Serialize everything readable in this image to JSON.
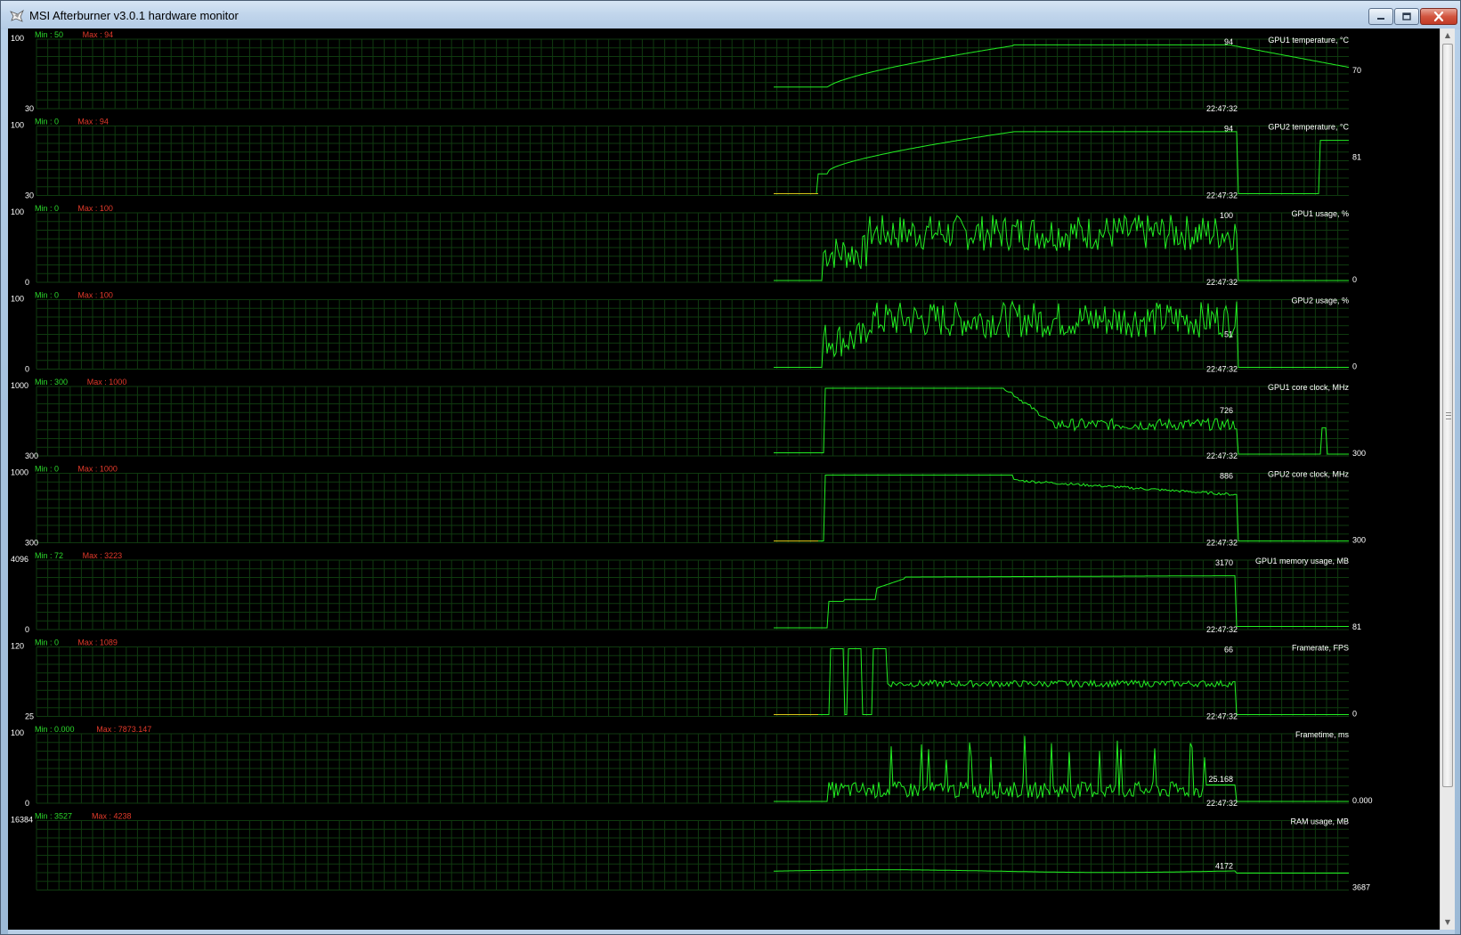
{
  "window": {
    "title": "MSI Afterburner v3.0.1 hardware monitor",
    "buttons": {
      "minimize": "minimize-icon",
      "maximize": "maximize-icon",
      "close": "close-icon"
    }
  },
  "colors": {
    "background": "#000000",
    "grid": "#0f3a0f",
    "trace": "#22ee22",
    "trace_idle": "#d8c818",
    "min_label": "#2bd92b",
    "max_label": "#e23a2a",
    "text": "#ffffff"
  },
  "monitor": {
    "timestamp": "22:47:32",
    "graphs": [
      {
        "title": "GPU1 temperature, °C",
        "min_text": "Min : 50",
        "max_text": "Max : 94",
        "y_top": "100",
        "y_bottom": "30",
        "current": "94",
        "right_value": "70"
      },
      {
        "title": "GPU2 temperature, °C",
        "min_text": "Min : 0",
        "max_text": "Max : 94",
        "y_top": "100",
        "y_bottom": "30",
        "current": "94",
        "right_value": "81"
      },
      {
        "title": "GPU1 usage, %",
        "min_text": "Min : 0",
        "max_text": "Max : 100",
        "y_top": "100",
        "y_bottom": "0",
        "current": "100",
        "right_value": "0"
      },
      {
        "title": "GPU2 usage, %",
        "min_text": "Min : 0",
        "max_text": "Max : 100",
        "y_top": "100",
        "y_bottom": "0",
        "current": "51",
        "right_value": "0"
      },
      {
        "title": "GPU1 core clock, MHz",
        "min_text": "Min : 300",
        "max_text": "Max : 1000",
        "y_top": "1000",
        "y_bottom": "300",
        "current": "726",
        "right_value": "300"
      },
      {
        "title": "GPU2 core clock, MHz",
        "min_text": "Min : 0",
        "max_text": "Max : 1000",
        "y_top": "1000",
        "y_bottom": "300",
        "current": "886",
        "right_value": "300"
      },
      {
        "title": "GPU1 memory usage, MB",
        "min_text": "Min : 72",
        "max_text": "Max : 3223",
        "y_top": "4096",
        "y_bottom": "0",
        "current": "3170",
        "right_value": "81"
      },
      {
        "title": "Framerate, FPS",
        "min_text": "Min : 0",
        "max_text": "Max : 1089",
        "y_top": "120",
        "y_bottom": "25",
        "current": "66",
        "right_value": "0"
      },
      {
        "title": "Frametime, ms",
        "min_text": "Min : 0.000",
        "max_text": "Max : 7873.147",
        "y_top": "100",
        "y_bottom": "0",
        "current": "25.168",
        "right_value": "0.000"
      },
      {
        "title": "RAM usage, MB",
        "min_text": "Min : 3527",
        "max_text": "Max : 4238",
        "y_top": "16384",
        "y_bottom": "",
        "current": "4172",
        "right_value": "3687"
      }
    ]
  },
  "scrollbar": {
    "up_icon": "▲",
    "down_icon": "▼"
  }
}
